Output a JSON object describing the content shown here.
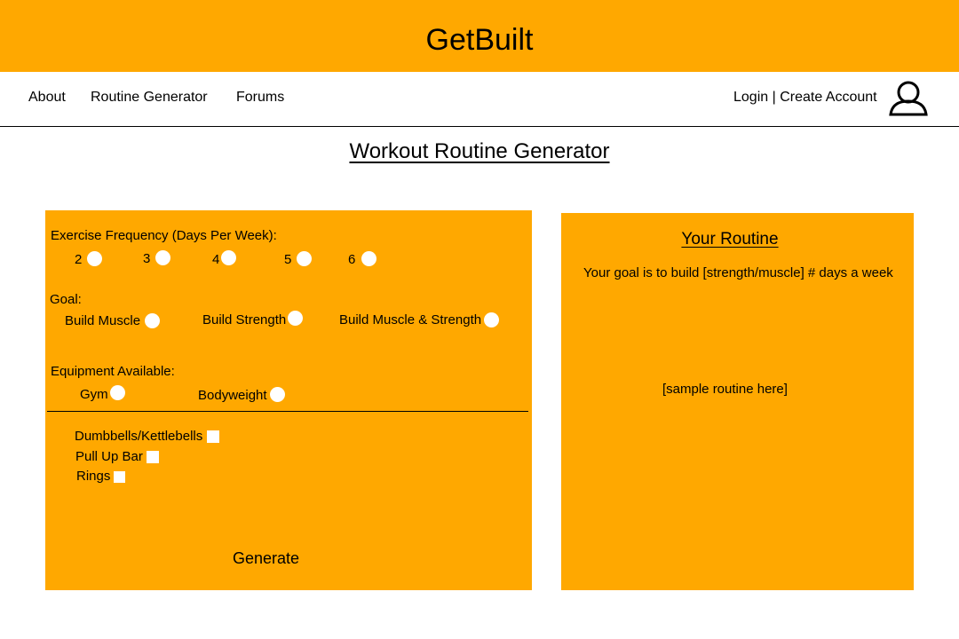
{
  "header": {
    "title": "GetBuilt",
    "accent": "#ffa800"
  },
  "nav": {
    "about": "About",
    "routine_generator": "Routine Generator",
    "forums": "Forums",
    "login": "Login | Create Account"
  },
  "page_title": "Workout Routine Generator",
  "form": {
    "frequency_label": "Exercise Frequency (Days Per Week):",
    "frequency_options": [
      "2",
      "3",
      "4",
      "5",
      "6"
    ],
    "goal_label": "Goal:",
    "goal_options": [
      "Build Muscle",
      "Build Strength",
      "Build Muscle & Strength"
    ],
    "equipment_label": "Equipment Available:",
    "equipment_options": [
      "Gym",
      "Bodyweight"
    ],
    "equipment_items": [
      "Dumbbells/Kettlebells",
      "Pull Up Bar",
      "Rings"
    ],
    "generate": "Generate"
  },
  "routine": {
    "title": "Your Routine",
    "goal_text": "Your goal is to build [strength/muscle] # days a week",
    "sample": "[sample routine here]"
  }
}
